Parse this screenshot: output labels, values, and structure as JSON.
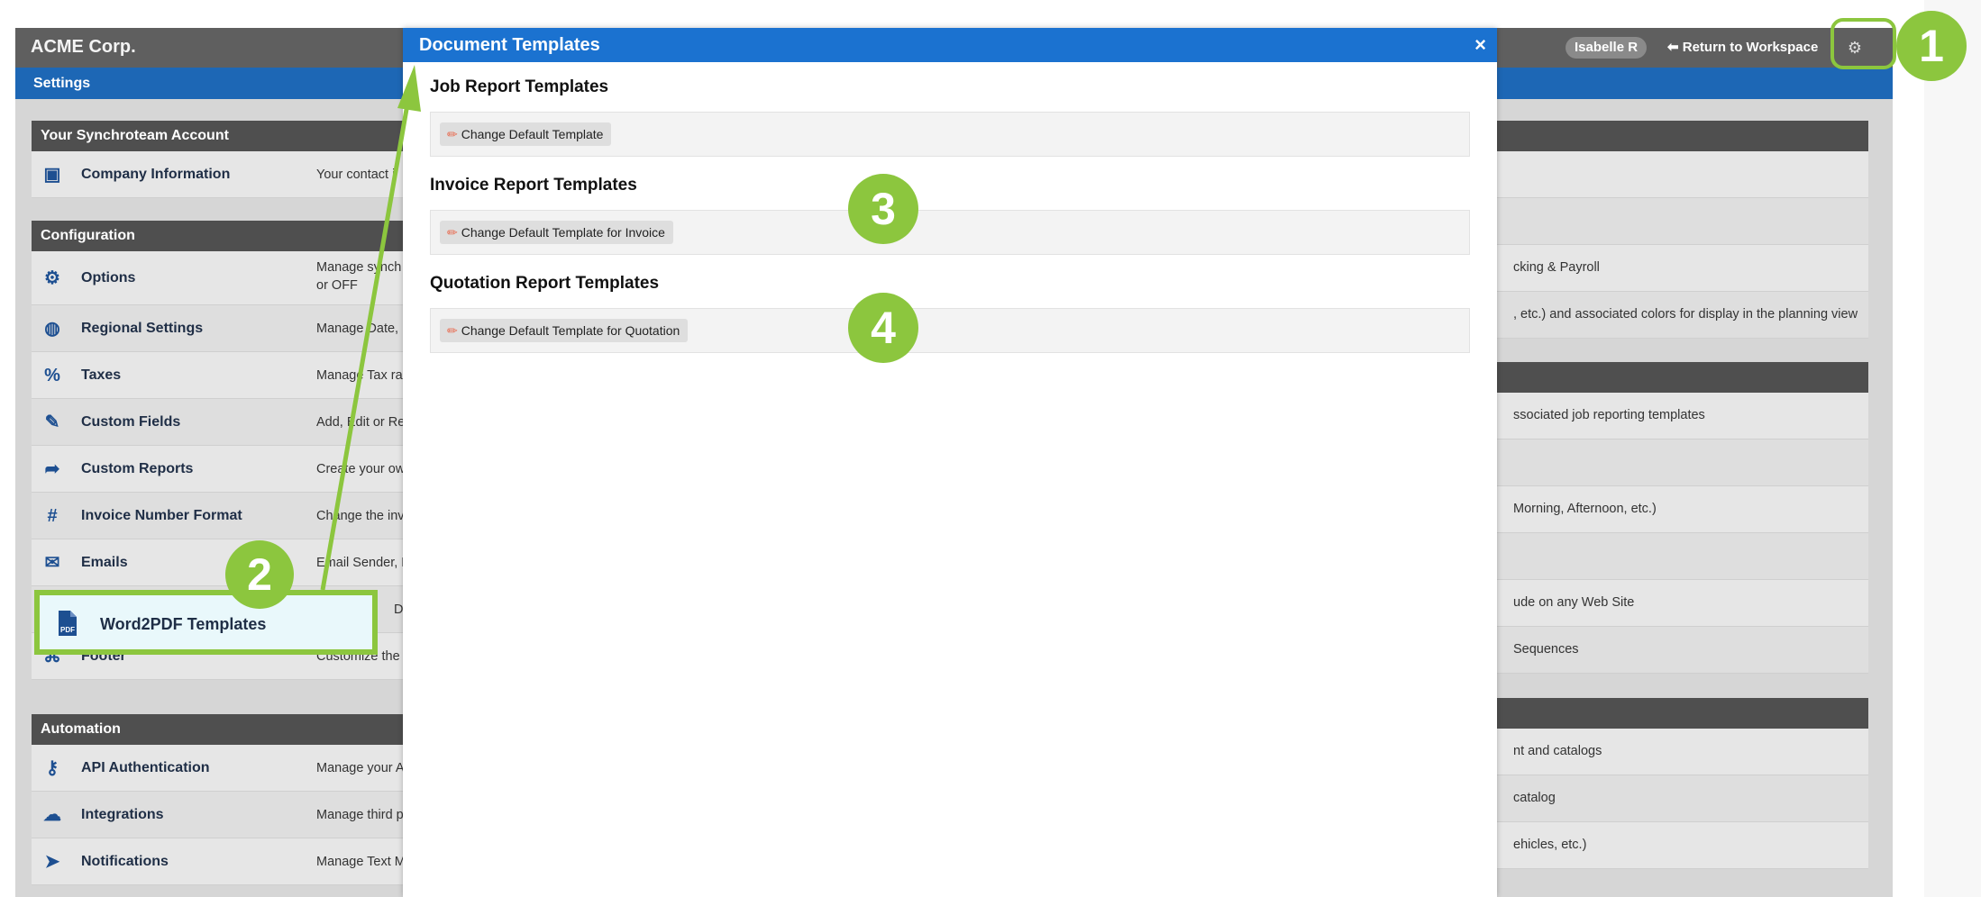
{
  "app": {
    "brand": "ACME Corp.",
    "user": "Isabelle R",
    "return_link": "⬅ Return to Workspace",
    "subbar_title": "Settings"
  },
  "sections": {
    "account": {
      "header": "Your Synchroteam Account",
      "rows": [
        {
          "label": "Company Information",
          "desc": "Your contact i",
          "icon": "id-card-icon"
        }
      ]
    },
    "configuration": {
      "header": "Configuration",
      "rows": [
        {
          "label": "Options",
          "desc": "Manage synch ON or OFF",
          "icon": "gear-icon"
        },
        {
          "label": "Regional Settings",
          "desc": "Manage Date, ",
          "icon": "globe-icon"
        },
        {
          "label": "Taxes",
          "desc": "Manage Tax ra",
          "icon": "percent-icon"
        },
        {
          "label": "Custom Fields",
          "desc": "Add, Edit or Re",
          "icon": "edit-icon"
        },
        {
          "label": "Custom Reports",
          "desc": "Create your ow",
          "icon": "file-export-icon"
        },
        {
          "label": "Invoice Number Format",
          "desc": "Change the inv",
          "icon": "hash-icon"
        },
        {
          "label": "Emails",
          "desc": "Email Sender, D",
          "icon": "envelope-icon"
        },
        {
          "label": "Word2PDF Templates",
          "desc": "Defa",
          "icon": "pdf-file-icon"
        },
        {
          "label": "Footer",
          "desc": "Customize the",
          "icon": "code-file-icon"
        }
      ]
    },
    "automation": {
      "header": "Automation",
      "rows": [
        {
          "label": "API Authentication",
          "desc": "Manage your A",
          "icon": "key-icon"
        },
        {
          "label": "Integrations",
          "desc": "Manage third p",
          "icon": "cloud-icon"
        },
        {
          "label": "Notifications",
          "desc": "Manage Text M",
          "icon": "paper-plane-icon"
        }
      ]
    }
  },
  "right_panel": {
    "group1": [
      "",
      "",
      "cking & Payroll",
      ", etc.) and associated colors for display in the planning view"
    ],
    "group2": [
      "ssociated job reporting templates",
      "",
      "Morning, Afternoon, etc.)",
      "",
      "ude on any Web Site",
      " Sequences"
    ],
    "group3": [
      "nt and catalogs",
      "catalog",
      "ehicles, etc.)"
    ]
  },
  "modal": {
    "title": "Document Templates",
    "close": "×",
    "job": {
      "title": "Job Report Templates",
      "button": "Change Default Template"
    },
    "invoice": {
      "title": "Invoice Report Templates",
      "button": "Change Default Template for Invoice"
    },
    "quotation": {
      "title": "Quotation Report Templates",
      "button": "Change Default Template for Quotation"
    }
  },
  "callouts": {
    "one": "1",
    "two": "2",
    "three": "3",
    "four": "4"
  },
  "colors": {
    "accent_green": "#8cc63e",
    "modal_blue": "#1b72d0",
    "subbar_blue": "#1d67b5"
  }
}
